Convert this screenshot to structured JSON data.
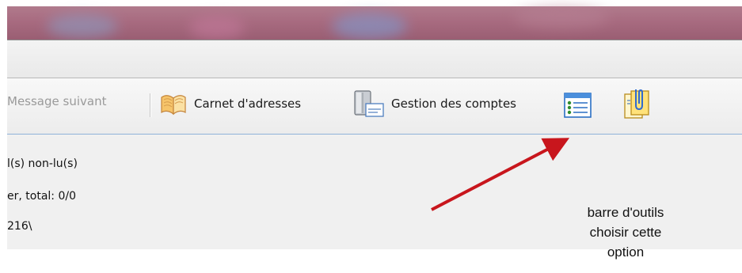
{
  "toolbar": {
    "next_message_label": "Message suivant",
    "address_book_label": "Carnet d'adresses",
    "accounts_label": "Gestion des comptes"
  },
  "status": {
    "line1": "l(s) non-lu(s)",
    "line2": "er, total: 0/0",
    "line3": "216\\"
  },
  "annotation": {
    "line1": "barre d'outils",
    "line2": "choisir cette",
    "line3": "option"
  },
  "icons": {
    "address_book": "open-book-icon",
    "accounts": "accounts-mail-icon",
    "layout": "window-layout-icon",
    "attachment": "paperclip-clipboard-icon"
  },
  "colors": {
    "title_bar": "#a86b80",
    "toolbar_border": "#8fb2d9",
    "arrow": "#c8161d"
  }
}
